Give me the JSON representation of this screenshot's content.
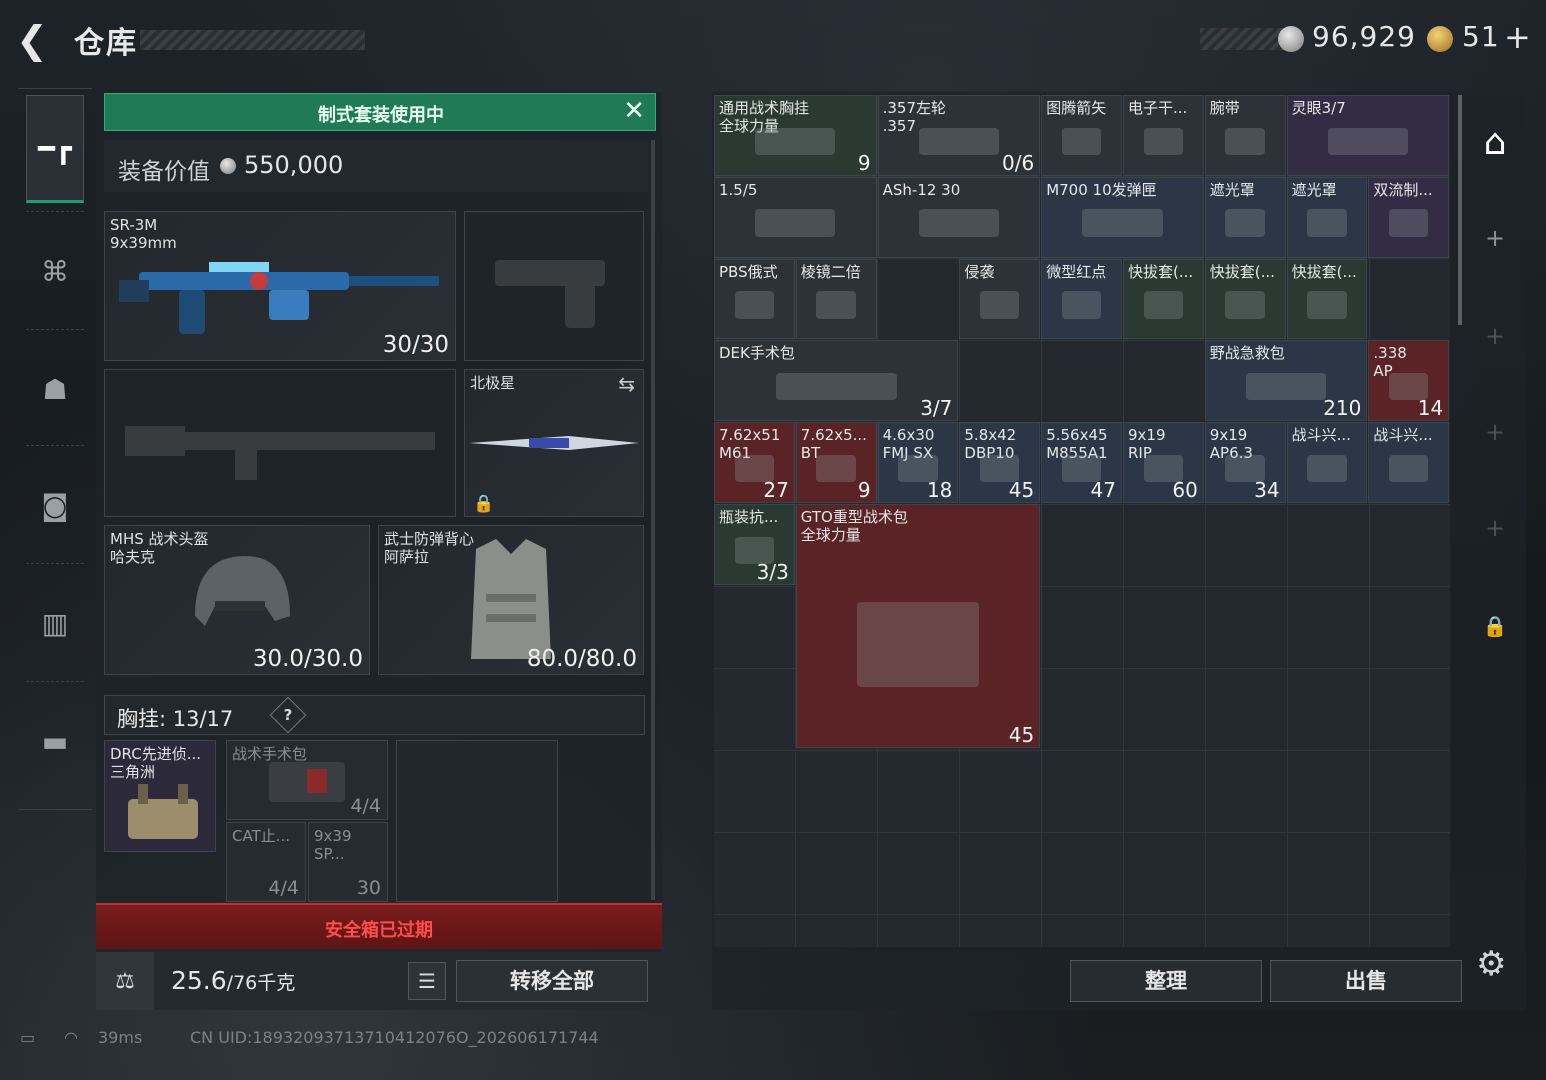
{
  "header": {
    "back_icon": "back-arrow-icon",
    "title": "仓库",
    "silver_amount": "96,929",
    "gold_amount": "51",
    "gold_plus": "+"
  },
  "left_nav": [
    "gun-icon",
    "armor-icon",
    "chest-rig-icon",
    "backpack-icon",
    "container-icon",
    "briefcase-icon"
  ],
  "loadout": {
    "kit_banner": "制式套装使用中",
    "value_label": "装备价值",
    "value": "550,000",
    "primary": {
      "name": "SR-3M\n9x39mm",
      "count": "30/30"
    },
    "melee": {
      "name": "北极星"
    },
    "helmet": {
      "name": "MHS 战术头盔\n哈夫克",
      "count": "30.0/30.0"
    },
    "armor": {
      "name": "武士防弹背心\n阿萨拉",
      "count": "80.0/80.0"
    },
    "chest_label": "胸挂: 13/17",
    "chest_help": "?",
    "rig_item": {
      "name": "DRC先进侦...\n三角洲"
    },
    "pouch_items": [
      {
        "name": "战术手术包",
        "count": "4/4"
      },
      {
        "name": "CAT止...",
        "count": "4/4"
      },
      {
        "name": "9x39\nSP...",
        "count": "30"
      }
    ],
    "safe_box": "安全箱已过期",
    "weight": "25.6",
    "weight_max": "/76千克",
    "transfer_all": "转移全部"
  },
  "grid_items": [
    {
      "name": "通用战术胸挂\n全球力量",
      "count": "9",
      "tone": "green"
    },
    {
      "name": ".357左轮\n.357",
      "count": "0/6",
      "tone": "gray"
    },
    {
      "name": "图腾箭矢",
      "count": "",
      "tone": "gray"
    },
    {
      "name": "电子干...",
      "count": "",
      "tone": "gray"
    },
    {
      "name": "腕带",
      "count": "",
      "tone": "gray"
    },
    {
      "name": "灵眼3/7",
      "count": "",
      "tone": "purple"
    },
    {
      "name": "1.5/5",
      "count": "",
      "tone": "gray"
    },
    {
      "name": "ASh-12 30",
      "count": "",
      "tone": "gray"
    },
    {
      "name": "M700 10发弹匣",
      "count": "",
      "tone": "blue"
    },
    {
      "name": "遮光罩",
      "count": "",
      "tone": "blue"
    },
    {
      "name": "遮光罩",
      "count": "",
      "tone": "blue"
    },
    {
      "name": "双流制...",
      "count": "",
      "tone": "purple"
    },
    {
      "name": "PBS俄式",
      "count": "",
      "tone": "gray"
    },
    {
      "name": "棱镜二倍",
      "count": "",
      "tone": "gray"
    },
    {
      "name": "侵袭",
      "count": "",
      "tone": "gray"
    },
    {
      "name": "微型红点",
      "count": "",
      "tone": "blue"
    },
    {
      "name": "快拔套(...",
      "count": "",
      "tone": "green"
    },
    {
      "name": "快拔套(...",
      "count": "",
      "tone": "green"
    },
    {
      "name": "快拔套(...",
      "count": "",
      "tone": "green"
    },
    {
      "name": "DEK手术包",
      "count": "3/7",
      "tone": "gray"
    },
    {
      "name": "野战急救包",
      "count": "210",
      "tone": "blue"
    },
    {
      "name": ".338\nAP",
      "count": "14",
      "tone": "red"
    },
    {
      "name": "7.62x51\nM61",
      "count": "27",
      "tone": "red"
    },
    {
      "name": "7.62x5...\nBT",
      "count": "9",
      "tone": "red"
    },
    {
      "name": "4.6x30\nFMJ SX",
      "count": "18",
      "tone": "blue"
    },
    {
      "name": "5.8x42\nDBP10",
      "count": "45",
      "tone": "blue"
    },
    {
      "name": "5.56x45\nM855A1",
      "count": "47",
      "tone": "blue"
    },
    {
      "name": "9x19\nRIP",
      "count": "60",
      "tone": "blue"
    },
    {
      "name": "9x19\nAP6.3",
      "count": "34",
      "tone": "blue"
    },
    {
      "name": "战斗兴...",
      "count": "",
      "tone": "blue"
    },
    {
      "name": "战斗兴...",
      "count": "",
      "tone": "blue"
    },
    {
      "name": "瓶装抗...",
      "count": "3/3",
      "tone": "green"
    },
    {
      "name": "GTO重型战术包\n全球力量",
      "count": "45",
      "tone": "red"
    }
  ],
  "actions": {
    "sort": "整理",
    "sell": "出售"
  },
  "footer": {
    "ping": "39ms",
    "uid": "CN UID:18932093713710412076O_202606171744"
  },
  "colors": {
    "accent_green": "#1f7a55",
    "danger_red": "#ff4d4d"
  }
}
